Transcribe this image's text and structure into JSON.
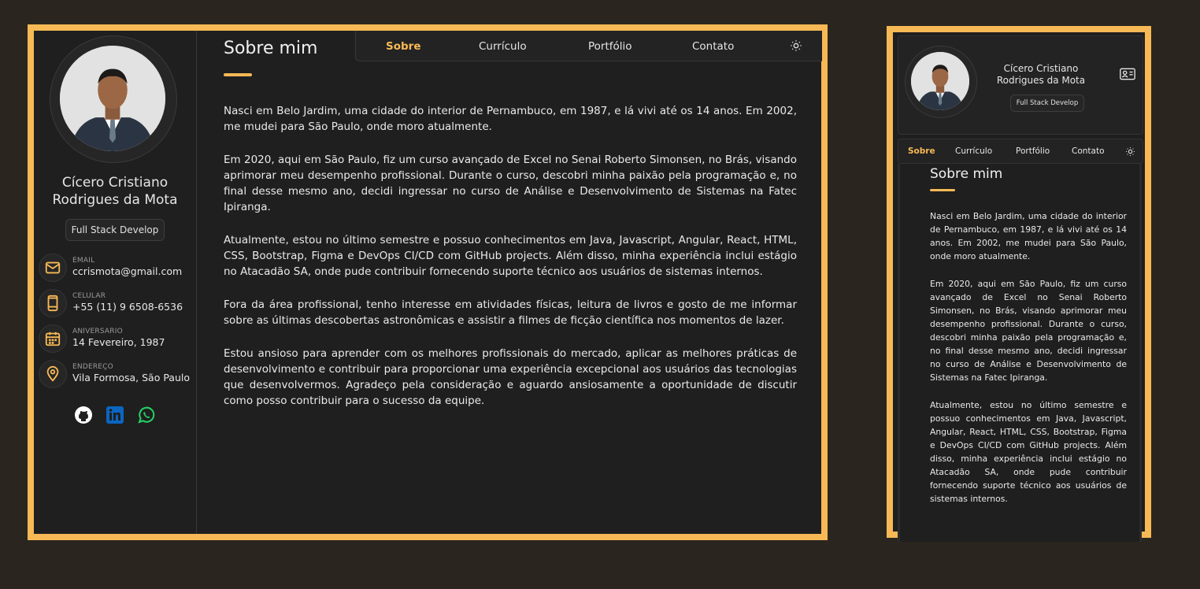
{
  "profile": {
    "name": "Cícero Cristiano Rodrigues da Mota",
    "name_line1": "Cícero Cristiano",
    "name_line2": "Rodrigues da Mota",
    "role": "Full Stack Develop"
  },
  "contacts": [
    {
      "label": "EMAIL",
      "value": "ccrismota@gmail.com",
      "icon": "mail-icon"
    },
    {
      "label": "CELULAR",
      "value": "+55 (11) 9 6508-6536",
      "icon": "phone-icon"
    },
    {
      "label": "ANIVERSARIO",
      "value": "14 Fevereiro, 1987",
      "icon": "calendar-icon"
    },
    {
      "label": "ENDEREÇO",
      "value": "Vila Formosa, São Paulo",
      "icon": "location-icon"
    }
  ],
  "socials": [
    {
      "name": "github-icon",
      "color": "#ffffff"
    },
    {
      "name": "linkedin-icon",
      "color": "#0a66c2"
    },
    {
      "name": "whatsapp-icon",
      "color": "#25d366"
    }
  ],
  "nav": {
    "items": [
      "Sobre",
      "Currículo",
      "Portfólio",
      "Contato"
    ],
    "active": "Sobre",
    "theme_icon": "sun-icon"
  },
  "about": {
    "title": "Sobre mim",
    "paragraphs": [
      "Nasci em Belo Jardim, uma cidade do interior de Pernambuco, em 1987, e lá vivi até os 14 anos. Em 2002, me mudei para São Paulo, onde moro atualmente.",
      "Em 2020, aqui em São Paulo, fiz um curso avançado de Excel no Senai Roberto Simonsen, no Brás, visando aprimorar meu desempenho profissional. Durante o curso, descobri minha paixão pela programação e, no final desse mesmo ano, decidi ingressar no curso de Análise e Desenvolvimento de Sistemas na Fatec Ipiranga.",
      "Atualmente, estou no último semestre e possuo conhecimentos em Java, Javascript, Angular, React, HTML, CSS, Bootstrap, Figma e DevOps CI/CD com GitHub projects. Além disso, minha experiência inclui estágio no Atacadão SA, onde pude contribuir fornecendo suporte técnico aos usuários de sistemas internos.",
      "Fora da área profissional, tenho interesse em atividades físicas, leitura de livros e gosto de me informar sobre as últimas descobertas astronômicas e assistir a filmes de ficção científica nos momentos de lazer.",
      "Estou ansioso para aprender com os melhores profissionais do mercado, aplicar as melhores práticas de desenvolvimento e contribuir para proporcionar uma experiência excepcional aos usuários das tecnologias que desenvolvermos. Agradeço pela consideração e aguardo ansiosamente a oportunidade de discutir como posso contribuir para o sucesso da equipe."
    ]
  },
  "colors": {
    "accent": "#f7b955",
    "background": "#2a261f",
    "panel": "#1f1f1f"
  }
}
